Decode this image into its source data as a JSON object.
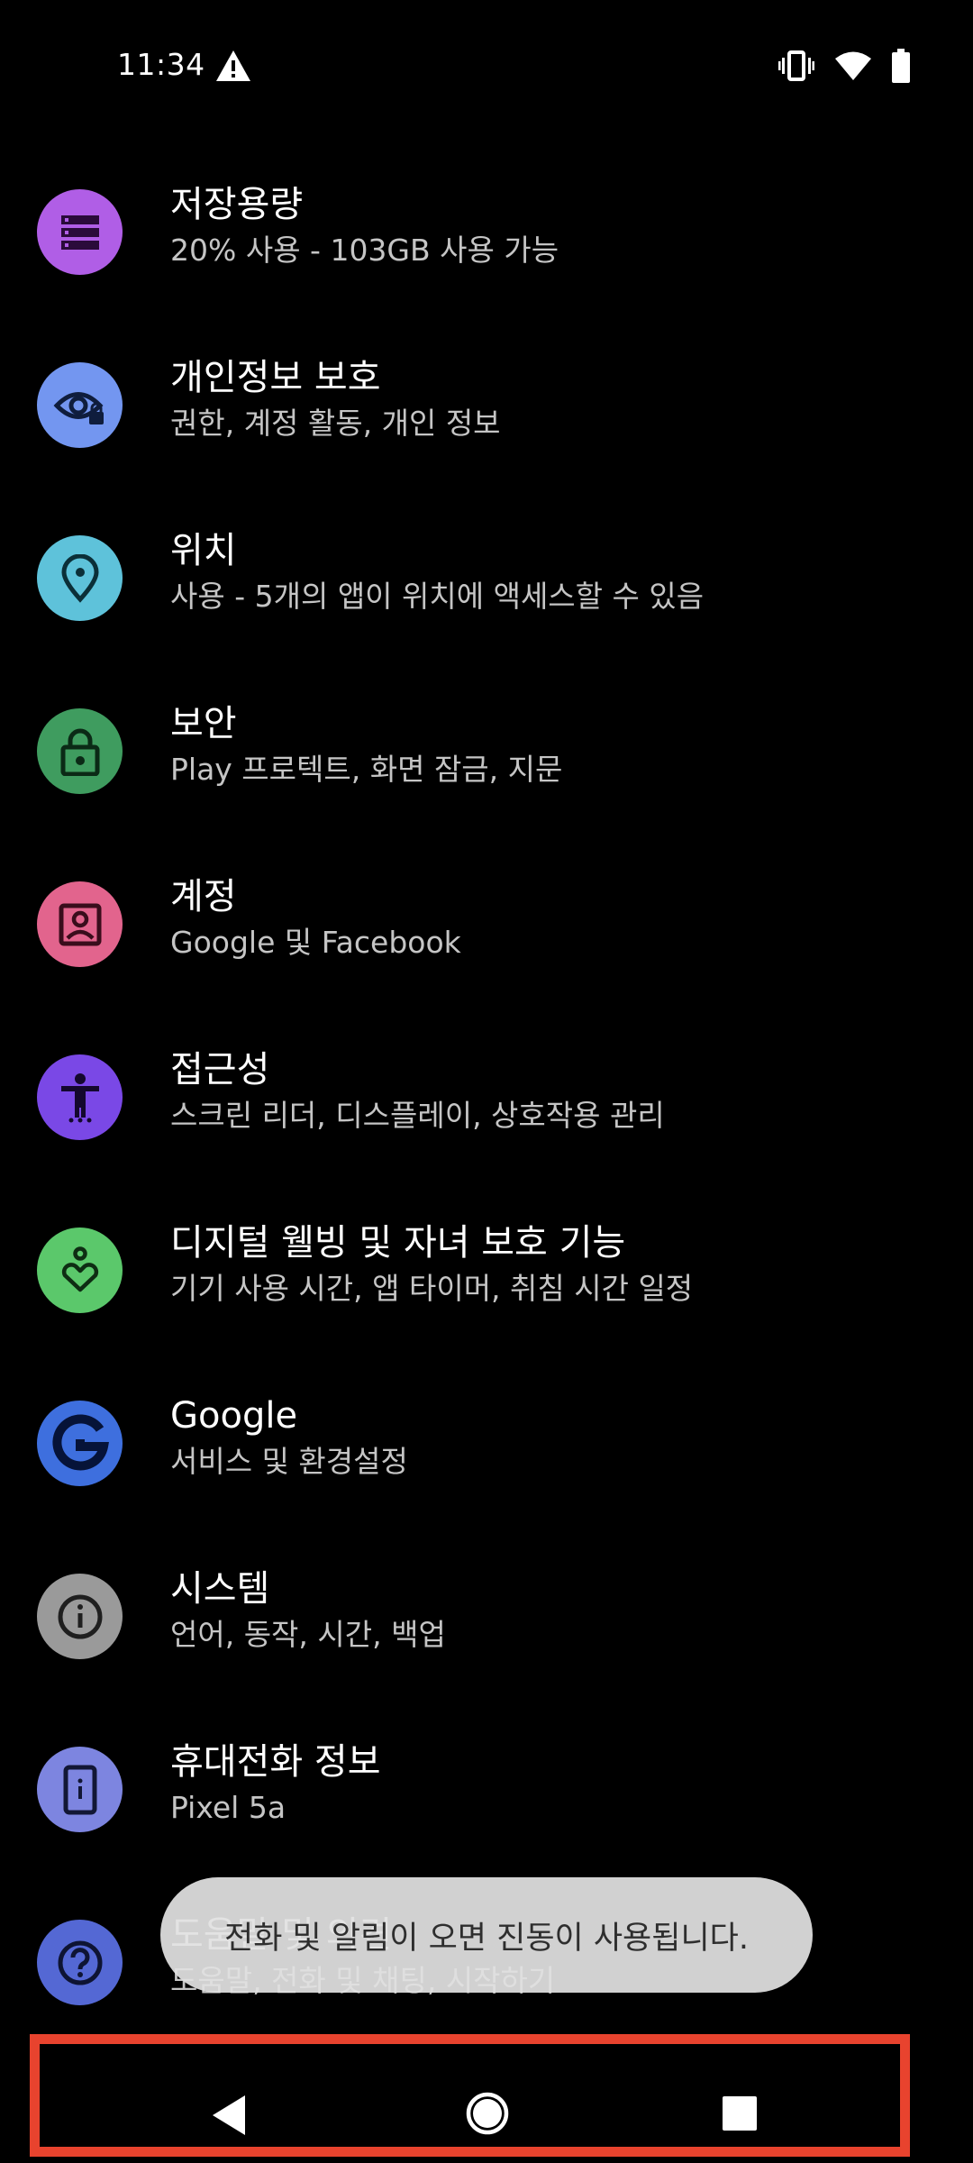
{
  "status_bar": {
    "time": "11:34",
    "left_icons": [
      "warning-icon"
    ],
    "right_icons": [
      "vibrate-icon",
      "wifi-icon",
      "battery-icon"
    ]
  },
  "settings": {
    "items": [
      {
        "title": "저장용량",
        "subtitle": "20% 사용 - 103GB 사용 가능",
        "icon": "storage-icon",
        "color": "#b05ee6"
      },
      {
        "title": "개인정보 보호",
        "subtitle": "권한, 계정 활동, 개인 정보",
        "icon": "privacy-icon",
        "color": "#7396f0"
      },
      {
        "title": "위치",
        "subtitle": "사용 - 5개의 앱이 위치에 액세스할 수 있음",
        "icon": "location-icon",
        "color": "#5ec2da"
      },
      {
        "title": "보안",
        "subtitle": "Play 프로텍트, 화면 잠금, 지문",
        "icon": "lock-icon",
        "color": "#3f9c5f"
      },
      {
        "title": "계정",
        "subtitle": "Google 및 Facebook",
        "icon": "account-icon",
        "color": "#e2648d"
      },
      {
        "title": "접근성",
        "subtitle": "스크린 리더, 디스플레이, 상호작용 관리",
        "icon": "accessibility-icon",
        "color": "#7a48e6"
      },
      {
        "title": "디지털 웰빙 및 자녀 보호 기능",
        "subtitle": "기기 사용 시간, 앱 타이머, 취침 시간 일정",
        "icon": "wellbeing-icon",
        "color": "#5bc86b"
      },
      {
        "title": "Google",
        "subtitle": "서비스 및 환경설정",
        "icon": "google-icon",
        "color": "#3e6fde"
      },
      {
        "title": "시스템",
        "subtitle": "언어, 동작, 시간, 백업",
        "icon": "info-icon",
        "color": "#9a9a9a"
      },
      {
        "title": "휴대전화 정보",
        "subtitle": "Pixel 5a",
        "icon": "phone-icon",
        "color": "#7d85e0"
      },
      {
        "title": "도움말 및 의견",
        "subtitle": "도움말, 전화 및 채팅, 시작하기",
        "icon": "help-icon",
        "color": "#5468d4"
      }
    ]
  },
  "toast": {
    "message": "전화 및 알림이 오면 진동이 사용됩니다."
  },
  "nav_bar": {
    "buttons": [
      "back-icon",
      "home-icon",
      "recents-icon"
    ],
    "highlight_color": "#e8432e"
  }
}
